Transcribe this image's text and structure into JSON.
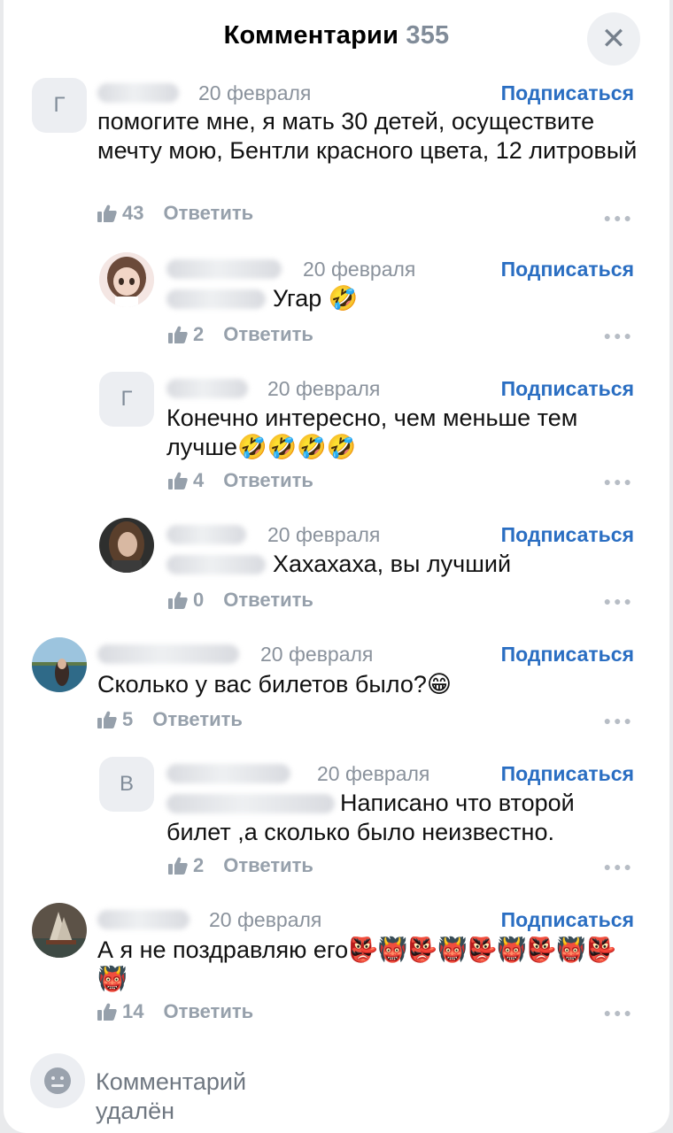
{
  "header": {
    "title": "Комментарии",
    "count": "355",
    "close_icon": "close-icon"
  },
  "subscribe_label": "Подписаться",
  "reply_label": "Ответить",
  "comments": [
    {
      "avatar_letter": "Г",
      "date": "20 февраля",
      "text": "помогите мне, я мать 30 детей, осуществите мечту мою, Бентли красного цвета, 12 литровый",
      "likes": "43"
    },
    {
      "date": "20 февраля",
      "text": "Угар 🤣",
      "likes": "2"
    },
    {
      "avatar_letter": "Г",
      "date": "20 февраля",
      "text": "Конечно интересно, чем меньше тем лучше🤣🤣🤣🤣",
      "likes": "4"
    },
    {
      "date": "20 февраля",
      "text": "Хахахаха, вы лучший",
      "likes": "0"
    },
    {
      "date": "20 февраля",
      "text": "Сколько у вас билетов было?😁",
      "likes": "5"
    },
    {
      "avatar_letter": "В",
      "date": "20 февраля",
      "text": "Написано что второй билет ,а сколько было неизвестно.",
      "likes": "2"
    },
    {
      "date": "20 февраля",
      "text": "А я не поздравляю его👺👹👺👹👺👹👺👹👺👹",
      "likes": "14"
    }
  ],
  "deleted": {
    "icon": "face-icon",
    "text": "Комментарий удалён"
  }
}
